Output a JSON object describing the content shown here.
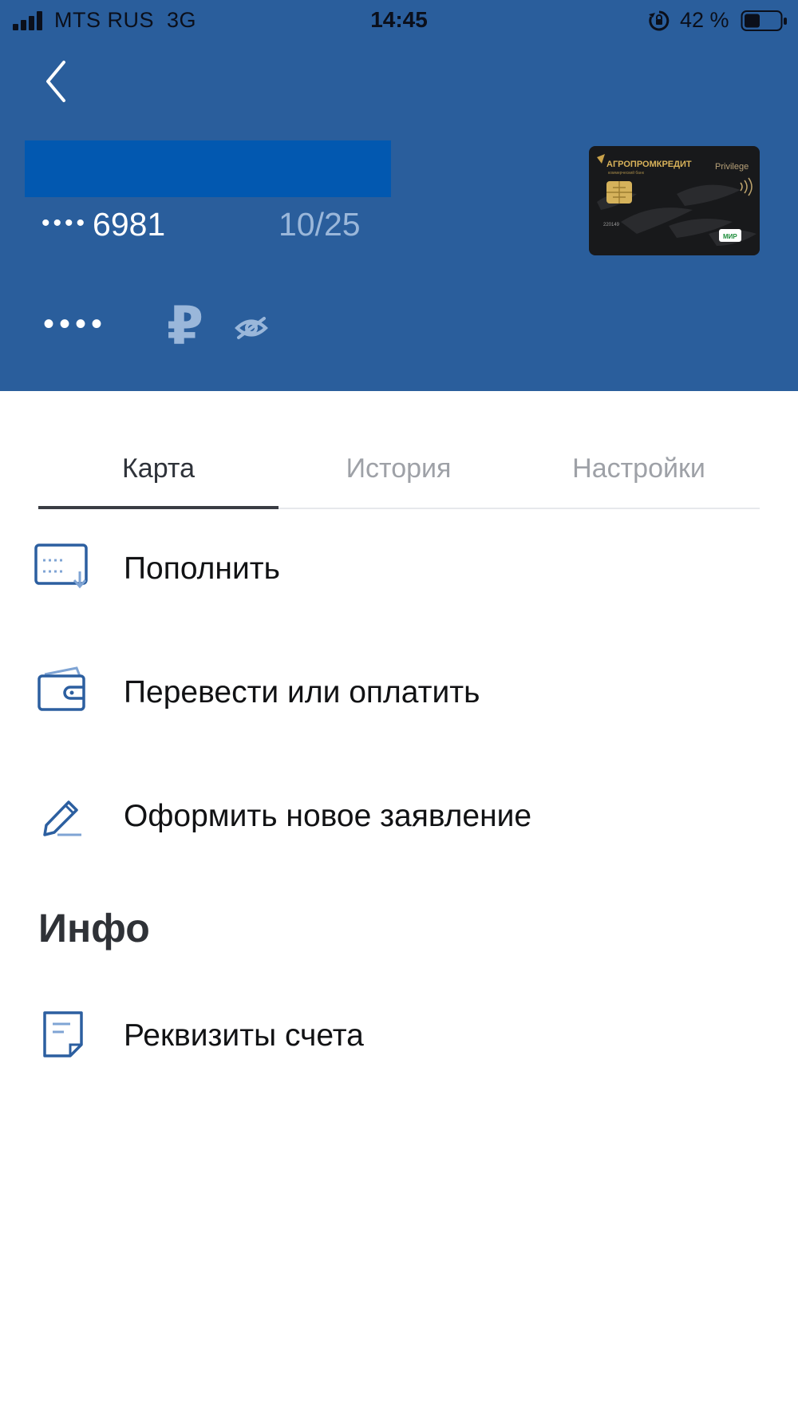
{
  "status": {
    "carrier": "MTS RUS",
    "network": "3G",
    "time": "14:45",
    "battery": "42 %"
  },
  "card": {
    "number_mask": "••••",
    "number_last": "6981",
    "expiry": "10/25",
    "balance_mask": "••••",
    "currency_symbol": "₽",
    "image": {
      "bank": "АГРОПРОМКРЕДИТ",
      "bank_sub": "коммерческий банк",
      "tier": "Privilege",
      "network": "МИР",
      "code": "220149"
    }
  },
  "tabs": [
    {
      "label": "Карта",
      "active": true
    },
    {
      "label": "История",
      "active": false
    },
    {
      "label": "Настройки",
      "active": false
    }
  ],
  "actions": [
    {
      "label": "Пополнить",
      "icon": "card-topup-icon"
    },
    {
      "label": "Перевести или оплатить",
      "icon": "wallet-icon"
    },
    {
      "label": "Оформить новое заявление",
      "icon": "pencil-icon"
    }
  ],
  "info": {
    "title": "Инфо",
    "items": [
      {
        "label": "Реквизиты счета",
        "icon": "document-icon"
      }
    ]
  },
  "colors": {
    "header_bg": "#2a5e9c",
    "accent_icon": "#2c5fa0",
    "muted_text": "#9ea1a7"
  }
}
